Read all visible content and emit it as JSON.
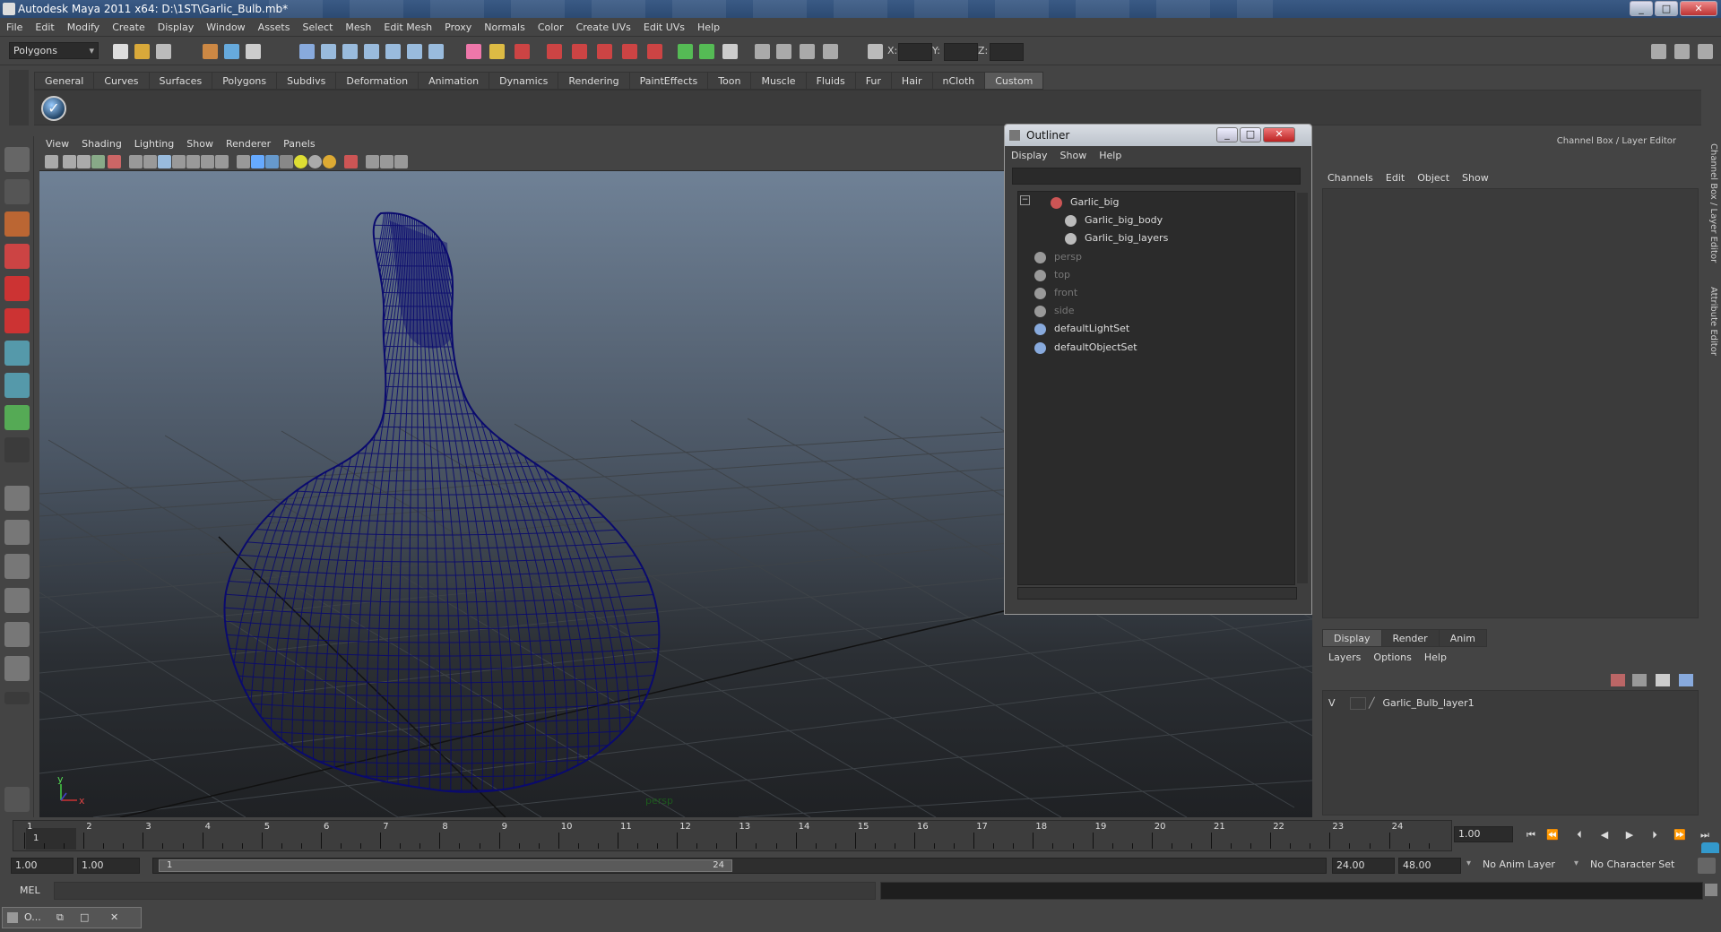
{
  "window": {
    "title": "Autodesk Maya 2011 x64: D:\\1ST\\Garlic_Bulb.mb*"
  },
  "menubar": [
    "File",
    "Edit",
    "Modify",
    "Create",
    "Display",
    "Window",
    "Assets",
    "Select",
    "Mesh",
    "Edit Mesh",
    "Proxy",
    "Normals",
    "Color",
    "Create UVs",
    "Edit UVs",
    "Help"
  ],
  "statusline": {
    "mode": "Polygons",
    "x_label": "X:",
    "y_label": "Y:",
    "z_label": "Z:"
  },
  "shelf": {
    "tabs": [
      "General",
      "Curves",
      "Surfaces",
      "Polygons",
      "Subdivs",
      "Deformation",
      "Animation",
      "Dynamics",
      "Rendering",
      "PaintEffects",
      "Toon",
      "Muscle",
      "Fluids",
      "Fur",
      "Hair",
      "nCloth",
      "Custom"
    ],
    "active_tab": "Custom"
  },
  "viewport": {
    "menu": [
      "View",
      "Shading",
      "Lighting",
      "Show",
      "Renderer",
      "Panels"
    ],
    "camera_label": "persp",
    "axis_y": "y",
    "axis_x": "x",
    "wire_color": "#0a0a6e"
  },
  "outliner": {
    "title": "Outliner",
    "menu": [
      "Display",
      "Show",
      "Help"
    ],
    "items": [
      {
        "label": "Garlic_big",
        "dim": false,
        "icon": "transform-icon"
      },
      {
        "label": "Garlic_big_body",
        "dim": false,
        "icon": "mesh-icon"
      },
      {
        "label": "Garlic_big_layers",
        "dim": false,
        "icon": "mesh-icon"
      },
      {
        "label": "persp",
        "dim": true,
        "icon": "camera-icon"
      },
      {
        "label": "top",
        "dim": true,
        "icon": "camera-icon"
      },
      {
        "label": "front",
        "dim": true,
        "icon": "camera-icon"
      },
      {
        "label": "side",
        "dim": true,
        "icon": "camera-icon"
      },
      {
        "label": "defaultLightSet",
        "dim": false,
        "icon": "set-icon"
      },
      {
        "label": "defaultObjectSet",
        "dim": false,
        "icon": "set-icon"
      }
    ]
  },
  "channelbox": {
    "title": "Channel Box / Layer Editor",
    "menu": [
      "Channels",
      "Edit",
      "Object",
      "Show"
    ],
    "side_tabs": [
      "Channel Box / Layer Editor",
      "Attribute Editor"
    ]
  },
  "layers": {
    "tabs": [
      "Display",
      "Render",
      "Anim"
    ],
    "active_tab": "Display",
    "menu": [
      "Layers",
      "Options",
      "Help"
    ],
    "rows": [
      {
        "visible": "V",
        "name": "Garlic_Bulb_layer1"
      }
    ]
  },
  "timeline": {
    "frames": [
      "1",
      "2",
      "3",
      "4",
      "5",
      "6",
      "7",
      "8",
      "9",
      "10",
      "11",
      "12",
      "13",
      "14",
      "15",
      "16",
      "17",
      "18",
      "19",
      "20",
      "21",
      "22",
      "23",
      "24"
    ],
    "current_marker": "1",
    "current_frame": "1.00"
  },
  "range": {
    "start": "1.00",
    "playback_start": "1.00",
    "slider_start": "1",
    "slider_end": "24",
    "playback_end": "24.00",
    "end": "48.00",
    "anim_layer": "No Anim Layer",
    "character_set": "No Character Set"
  },
  "commandline": {
    "label": "MEL"
  },
  "taskbar": {
    "item": "O..."
  }
}
